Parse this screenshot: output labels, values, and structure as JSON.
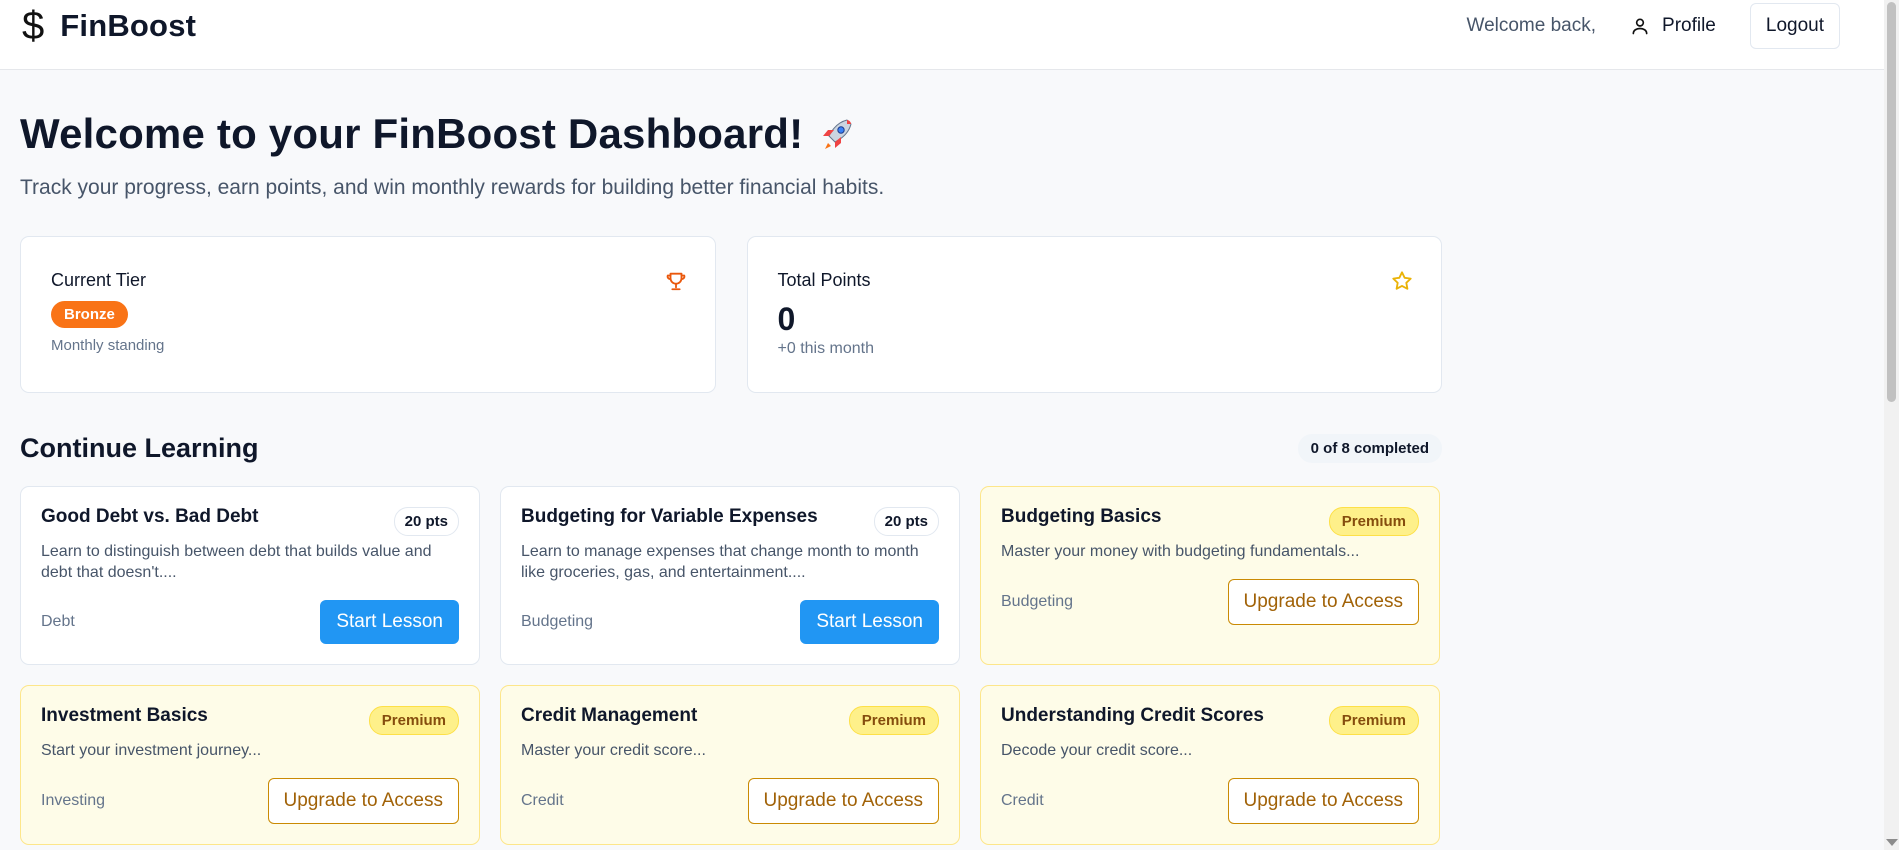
{
  "header": {
    "brand_icon": "$",
    "brand_name": "FinBoost",
    "welcome_text": "Welcome back,",
    "profile_label": "Profile",
    "logout_label": "Logout"
  },
  "hero": {
    "title": "Welcome to your FinBoost Dashboard!",
    "title_icon": "rocket-icon",
    "subtitle": "Track your progress, earn points, and win monthly rewards for building better financial habits."
  },
  "stats": {
    "tier": {
      "label": "Current Tier",
      "badge": "Bronze",
      "note": "Monthly standing",
      "icon": "trophy-icon",
      "accent": "#f97316"
    },
    "points": {
      "label": "Total Points",
      "value": "0",
      "note": "+0 this month",
      "icon": "star-icon",
      "accent": "#eab308"
    }
  },
  "learning": {
    "title": "Continue Learning",
    "progress": "0 of 8 completed",
    "lessons": [
      {
        "title": "Good Debt vs. Bad Debt",
        "badge": "20 pts",
        "desc": "Learn to distinguish between debt that builds value and debt that doesn't....",
        "category": "Debt",
        "action": "Start Lesson"
      },
      {
        "title": "Budgeting for Variable Expenses",
        "badge": "20 pts",
        "desc": "Learn to manage expenses that change month to month like groceries, gas, and entertainment....",
        "category": "Budgeting",
        "action": "Start Lesson"
      },
      {
        "title": "Budgeting Basics",
        "badge": "Premium",
        "desc": "Master your money with budgeting fundamentals...",
        "category": "Budgeting",
        "action": "Upgrade to Access"
      },
      {
        "title": "Investment Basics",
        "badge": "Premium",
        "desc": "Start your investment journey...",
        "category": "Investing",
        "action": "Upgrade to Access"
      },
      {
        "title": "Credit Management",
        "badge": "Premium",
        "desc": "Master your credit score...",
        "category": "Credit",
        "action": "Upgrade to Access"
      },
      {
        "title": "Understanding Credit Scores",
        "badge": "Premium",
        "desc": "Decode your credit score...",
        "category": "Credit",
        "action": "Upgrade to Access"
      }
    ]
  },
  "colors": {
    "primary_button": "#2196f3",
    "premium_bg": "#fefce8",
    "premium_text": "#a16207"
  }
}
